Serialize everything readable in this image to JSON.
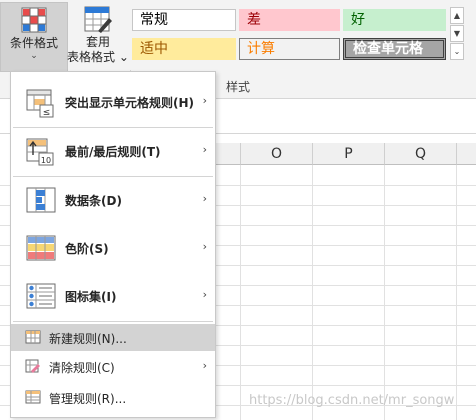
{
  "ribbon": {
    "conditional_format": {
      "label": "条件格式",
      "caret": "⌄"
    },
    "table_format": {
      "label_line1": "套用",
      "label_line2": "表格格式",
      "caret": "⌄"
    },
    "cell_styles": {
      "normal": "常规",
      "bad": "差",
      "good": "好",
      "neutral": "适中",
      "calculation": "计算",
      "check_cell": "检查单元格"
    },
    "scroll": {
      "up": "▲",
      "down": "▼",
      "more": "⌄"
    },
    "group_label": "样式"
  },
  "grid": {
    "columns": [
      "O",
      "P",
      "Q"
    ]
  },
  "menu": {
    "items": [
      {
        "label": "突出显示单元格规则(H)",
        "icon": "highlight-cells-rules-icon",
        "submenu": true
      },
      {
        "label": "最前/最后规则(T)",
        "icon": "top-bottom-rules-icon",
        "submenu": true
      },
      {
        "label": "数据条(D)",
        "icon": "data-bars-icon",
        "submenu": true
      },
      {
        "label": "色阶(S)",
        "icon": "color-scales-icon",
        "submenu": true
      },
      {
        "label": "图标集(I)",
        "icon": "icon-sets-icon",
        "submenu": true
      },
      {
        "label": "新建规则(N)...",
        "icon": "new-rule-icon",
        "submenu": false,
        "highlighted": true
      },
      {
        "label": "清除规则(C)",
        "icon": "clear-rules-icon",
        "submenu": true
      },
      {
        "label": "管理规则(R)...",
        "icon": "manage-rules-icon",
        "submenu": false
      }
    ],
    "submenu_arrow": "›"
  },
  "watermark": "https://blog.csdn.net/mr_songw"
}
